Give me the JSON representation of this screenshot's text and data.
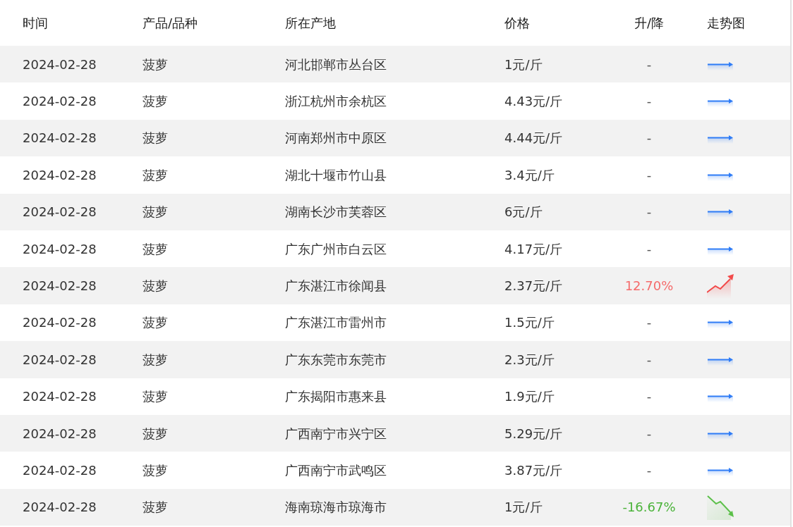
{
  "table": {
    "columns": [
      "时间",
      "产品/品种",
      "所在产地",
      "价格",
      "升/降",
      "走势图"
    ],
    "rows": [
      {
        "date": "2024-02-28",
        "product": "菠萝",
        "origin": "河北邯郸市丛台区",
        "price": "1元/斤",
        "change": "-",
        "kind": "flat"
      },
      {
        "date": "2024-02-28",
        "product": "菠萝",
        "origin": "浙江杭州市余杭区",
        "price": "4.43元/斤",
        "change": "-",
        "kind": "flat"
      },
      {
        "date": "2024-02-28",
        "product": "菠萝",
        "origin": "河南郑州市中原区",
        "price": "4.44元/斤",
        "change": "-",
        "kind": "flat"
      },
      {
        "date": "2024-02-28",
        "product": "菠萝",
        "origin": "湖北十堰市竹山县",
        "price": "3.4元/斤",
        "change": "-",
        "kind": "flat"
      },
      {
        "date": "2024-02-28",
        "product": "菠萝",
        "origin": "湖南长沙市芙蓉区",
        "price": "6元/斤",
        "change": "-",
        "kind": "flat"
      },
      {
        "date": "2024-02-28",
        "product": "菠萝",
        "origin": "广东广州市白云区",
        "price": "4.17元/斤",
        "change": "-",
        "kind": "flat"
      },
      {
        "date": "2024-02-28",
        "product": "菠萝",
        "origin": "广东湛江市徐闻县",
        "price": "2.37元/斤",
        "change": "12.70%",
        "kind": "up"
      },
      {
        "date": "2024-02-28",
        "product": "菠萝",
        "origin": "广东湛江市雷州市",
        "price": "1.5元/斤",
        "change": "-",
        "kind": "flat"
      },
      {
        "date": "2024-02-28",
        "product": "菠萝",
        "origin": "广东东莞市东莞市",
        "price": "2.3元/斤",
        "change": "-",
        "kind": "flat"
      },
      {
        "date": "2024-02-28",
        "product": "菠萝",
        "origin": "广东揭阳市惠来县",
        "price": "1.9元/斤",
        "change": "-",
        "kind": "flat"
      },
      {
        "date": "2024-02-28",
        "product": "菠萝",
        "origin": "广西南宁市兴宁区",
        "price": "5.29元/斤",
        "change": "-",
        "kind": "flat"
      },
      {
        "date": "2024-02-28",
        "product": "菠萝",
        "origin": "广西南宁市武鸣区",
        "price": "3.87元/斤",
        "change": "-",
        "kind": "flat"
      },
      {
        "date": "2024-02-28",
        "product": "菠萝",
        "origin": "海南琼海市琼海市",
        "price": "1元/斤",
        "change": "-16.67%",
        "kind": "down"
      }
    ]
  }
}
